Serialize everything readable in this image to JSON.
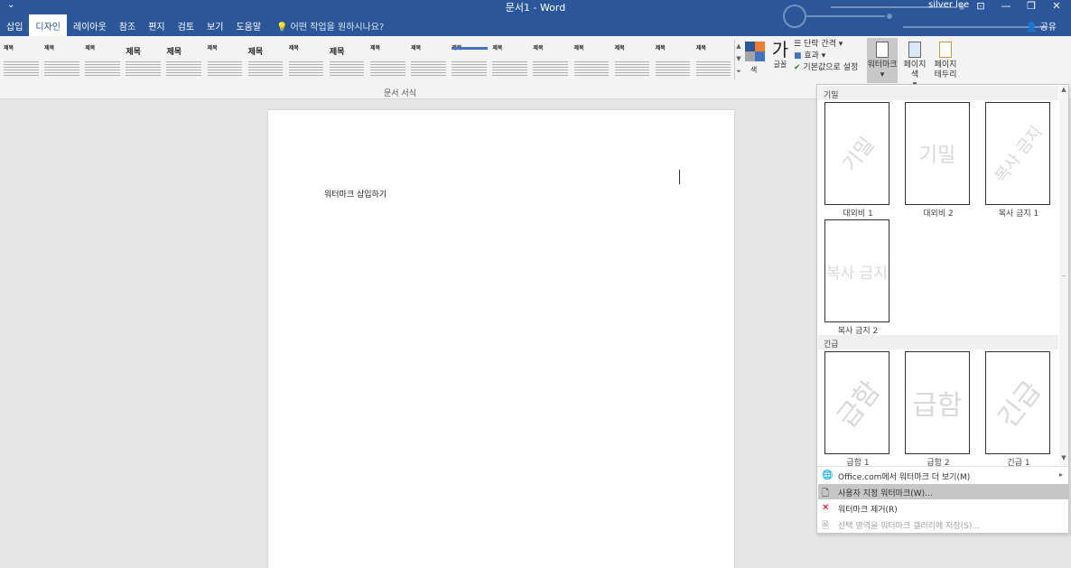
{
  "window": {
    "title": "문서1 - Word",
    "user": "silver lee",
    "qat_icon": "⌄",
    "controls": [
      "⊡",
      "—",
      "❐",
      "✕"
    ]
  },
  "tabs": [
    "삽입",
    "디자인",
    "레이아웃",
    "참조",
    "편지",
    "검토",
    "보기",
    "도움말"
  ],
  "active_tab": "디자인",
  "tell_me": "어떤 작업을 원하시나요?",
  "share": "공유",
  "ribbon": {
    "style_thumbs": [
      "제목",
      "제목",
      "제목",
      "제목",
      "제목",
      "제목",
      "제목",
      "제목",
      "제목",
      "제목",
      "제목",
      "제목",
      "제목",
      "제목",
      "제목",
      "제목",
      "제목",
      "제목"
    ],
    "group_label": "문서 서식",
    "colors_label": "색",
    "fonts_label": "글꼴",
    "fonts_glyph": "가",
    "paragraph_spacing": "단락 간격 ▾",
    "effects": "효과 ▾",
    "set_default": "기본값으로 설정",
    "watermark": "워터마크",
    "page_color": "페이지 색",
    "page_borders": "페이지 테두리",
    "accent_colors": [
      "#2b579a",
      "#ed7d31",
      "#a5a5a5",
      "#4472c4"
    ]
  },
  "document": {
    "text": "워터마크 삽입하기"
  },
  "dropdown": {
    "sections": [
      {
        "header": "기밀",
        "items": [
          {
            "text": "기밀",
            "caption": "대외비 1",
            "style": "diag"
          },
          {
            "text": "기밀",
            "caption": "대외비 2",
            "style": "plain"
          },
          {
            "text": "복사 금지",
            "caption": "복사 금지 1",
            "style": "diag"
          },
          {
            "text": "복사 금지",
            "caption": "복사 금지 2",
            "style": "plain"
          }
        ]
      },
      {
        "header": "긴급",
        "items": [
          {
            "text": "급함",
            "caption": "급함 1",
            "style": "diag"
          },
          {
            "text": "급함",
            "caption": "급함 2",
            "style": "plain"
          },
          {
            "text": "긴급",
            "caption": "긴급 1",
            "style": "diag"
          }
        ]
      }
    ],
    "menu": {
      "office": "Office.com에서 워터마크 더 보기(M)",
      "custom": "사용자 지정 워터마크(W)...",
      "remove": "워터마크 제거(R)",
      "save": "선택 영역을 워터마크 갤러리에 저장(S)..."
    }
  }
}
